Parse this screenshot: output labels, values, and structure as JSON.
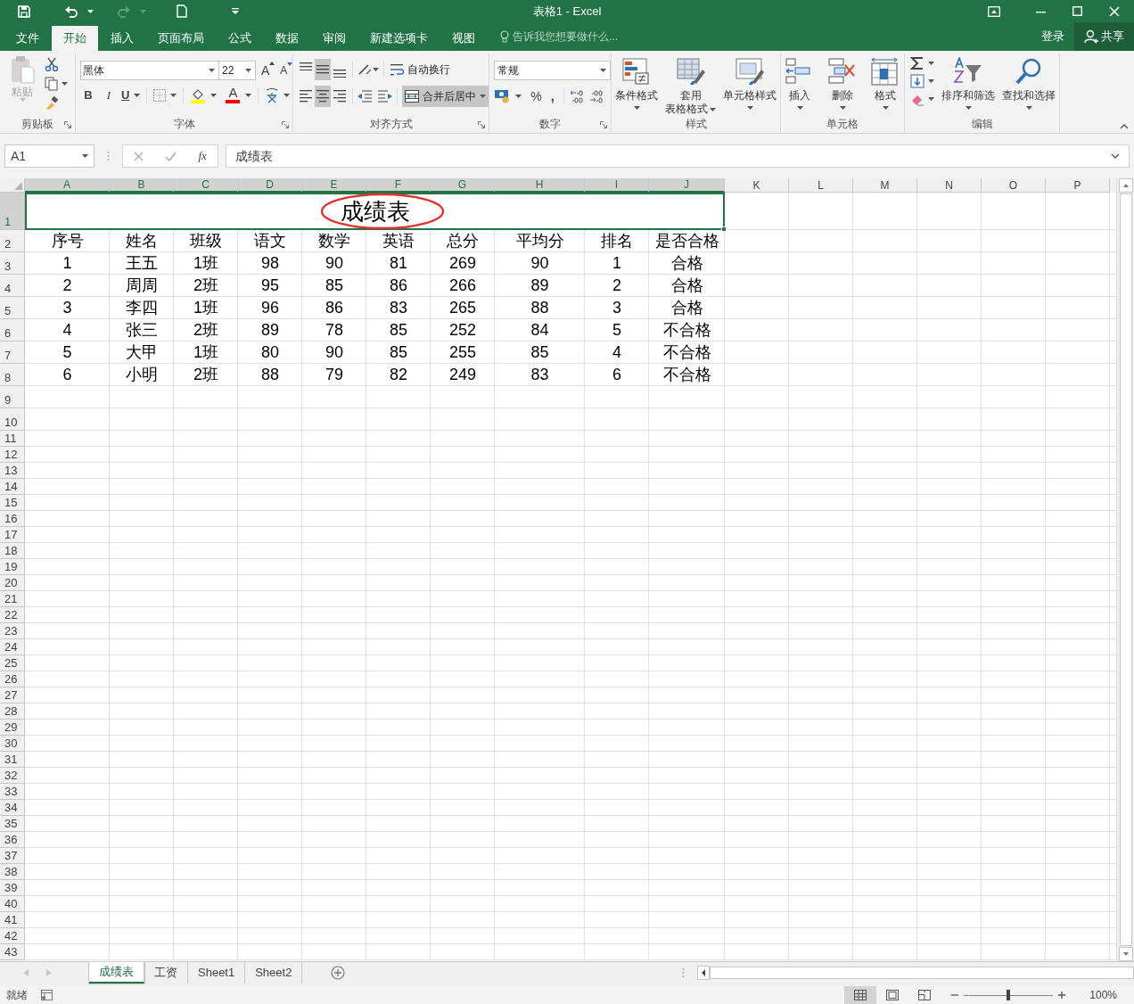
{
  "window": {
    "title": "表格1 - Excel"
  },
  "menu_tabs": [
    {
      "label": "文件",
      "selected": false
    },
    {
      "label": "开始",
      "selected": true
    },
    {
      "label": "插入",
      "selected": false
    },
    {
      "label": "页面布局",
      "selected": false
    },
    {
      "label": "公式",
      "selected": false
    },
    {
      "label": "数据",
      "selected": false
    },
    {
      "label": "审阅",
      "selected": false
    },
    {
      "label": "新建选项卡",
      "selected": false
    },
    {
      "label": "视图",
      "selected": false
    }
  ],
  "tell_me": {
    "placeholder": "告诉我您想要做什么..."
  },
  "account": {
    "sign_in": "登录",
    "share": "共享"
  },
  "ribbon": {
    "groups": [
      {
        "label": "剪贴板",
        "paste": {
          "label": "粘贴",
          "disabled": true
        }
      },
      {
        "label": "字体",
        "font_name": "黑体",
        "font_size": "22",
        "grow": "A",
        "shrink": "A",
        "bold": "B",
        "italic": "I",
        "underline": "U",
        "font_color": "A"
      },
      {
        "label": "对齐方式",
        "vertical": [
          {
            "kind": "top",
            "selected": false
          },
          {
            "kind": "middle",
            "selected": true
          },
          {
            "kind": "bottom",
            "selected": false
          }
        ],
        "horizontal": [
          {
            "kind": "left",
            "selected": false
          },
          {
            "kind": "center",
            "selected": true
          },
          {
            "kind": "right",
            "selected": false
          }
        ],
        "wrap_text": {
          "label": "自动换行",
          "selected": false
        },
        "merge": {
          "label": "合并后居中",
          "selected": true
        }
      },
      {
        "label": "数字",
        "format": "常规",
        "percent": "%",
        "comma": ","
      },
      {
        "label": "样式",
        "buttons": [
          {
            "kind": "conditional",
            "lines": [
              "条件格式"
            ]
          },
          {
            "kind": "table",
            "lines": [
              "套用",
              "表格格式"
            ]
          },
          {
            "kind": "cell_styles",
            "lines": [
              "单元格样式"
            ]
          }
        ]
      },
      {
        "label": "单元格",
        "buttons": [
          {
            "kind": "insert",
            "lines": [
              "插入"
            ]
          },
          {
            "kind": "delete",
            "lines": [
              "删除"
            ]
          },
          {
            "kind": "format",
            "lines": [
              "格式"
            ]
          }
        ]
      },
      {
        "label": "编辑",
        "buttons": [
          {
            "kind": "sort",
            "lines": [
              "排序和筛选"
            ]
          },
          {
            "kind": "find",
            "lines": [
              "查找和选择"
            ]
          }
        ]
      }
    ]
  },
  "formula_bar": {
    "name_box": "A1",
    "function_label": "fx",
    "value": "成绩表"
  },
  "sheet": {
    "columns": [
      {
        "label": "A",
        "selected": true
      },
      {
        "label": "B",
        "selected": true
      },
      {
        "label": "C",
        "selected": true
      },
      {
        "label": "D",
        "selected": true
      },
      {
        "label": "E",
        "selected": true
      },
      {
        "label": "F",
        "selected": true
      },
      {
        "label": "G",
        "selected": true
      },
      {
        "label": "H",
        "selected": true
      },
      {
        "label": "I",
        "selected": true
      },
      {
        "label": "J",
        "selected": true
      },
      {
        "label": "K",
        "selected": false
      },
      {
        "label": "L",
        "selected": false
      },
      {
        "label": "M",
        "selected": false
      },
      {
        "label": "N",
        "selected": false
      },
      {
        "label": "O",
        "selected": false
      },
      {
        "label": "P",
        "selected": false
      }
    ],
    "title_row": {
      "number": "1",
      "selected": true,
      "text": "成绩表",
      "circled": true
    },
    "rows": [
      {
        "number": "2",
        "selected": false,
        "cells": [
          "序号",
          "姓名",
          "班级",
          "语文",
          "数学",
          "英语",
          "总分",
          "平均分",
          "排名",
          "是否合格"
        ]
      },
      {
        "number": "3",
        "selected": false,
        "cells": [
          "1",
          "王五",
          "1班",
          "98",
          "90",
          "81",
          "269",
          "90",
          "1",
          "合格"
        ]
      },
      {
        "number": "4",
        "selected": false,
        "cells": [
          "2",
          "周周",
          "2班",
          "95",
          "85",
          "86",
          "266",
          "89",
          "2",
          "合格"
        ]
      },
      {
        "number": "5",
        "selected": false,
        "cells": [
          "3",
          "李四",
          "1班",
          "96",
          "86",
          "83",
          "265",
          "88",
          "3",
          "合格"
        ]
      },
      {
        "number": "6",
        "selected": false,
        "cells": [
          "4",
          "张三",
          "2班",
          "89",
          "78",
          "85",
          "252",
          "84",
          "5",
          "不合格"
        ]
      },
      {
        "number": "7",
        "selected": false,
        "cells": [
          "5",
          "大甲",
          "1班",
          "80",
          "90",
          "85",
          "255",
          "85",
          "4",
          "不合格"
        ]
      },
      {
        "number": "8",
        "selected": false,
        "cells": [
          "6",
          "小明",
          "2班",
          "88",
          "79",
          "82",
          "249",
          "83",
          "6",
          "不合格"
        ]
      },
      {
        "number": "9",
        "selected": false
      },
      {
        "number": "10",
        "selected": false
      },
      {
        "number": "11",
        "selected": false
      },
      {
        "number": "12",
        "selected": false
      },
      {
        "number": "13",
        "selected": false
      },
      {
        "number": "14",
        "selected": false
      },
      {
        "number": "15",
        "selected": false
      },
      {
        "number": "16",
        "selected": false
      },
      {
        "number": "17",
        "selected": false
      },
      {
        "number": "18",
        "selected": false
      },
      {
        "number": "19",
        "selected": false
      },
      {
        "number": "20",
        "selected": false
      },
      {
        "number": "21",
        "selected": false
      },
      {
        "number": "22",
        "selected": false
      },
      {
        "number": "23",
        "selected": false
      },
      {
        "number": "24",
        "selected": false
      },
      {
        "number": "25",
        "selected": false
      },
      {
        "number": "26",
        "selected": false
      },
      {
        "number": "27",
        "selected": false
      },
      {
        "number": "28",
        "selected": false
      },
      {
        "number": "29",
        "selected": false
      },
      {
        "number": "30",
        "selected": false
      },
      {
        "number": "31",
        "selected": false
      },
      {
        "number": "32",
        "selected": false
      },
      {
        "number": "33",
        "selected": false
      },
      {
        "number": "34",
        "selected": false
      },
      {
        "number": "35",
        "selected": false
      },
      {
        "number": "36",
        "selected": false
      },
      {
        "number": "37",
        "selected": false
      },
      {
        "number": "38",
        "selected": false
      },
      {
        "number": "39",
        "selected": false
      },
      {
        "number": "40",
        "selected": false
      },
      {
        "number": "41",
        "selected": false
      },
      {
        "number": "42",
        "selected": false
      },
      {
        "number": "43",
        "selected": false
      }
    ]
  },
  "sheet_tabs": [
    {
      "label": "成绩表",
      "selected": true
    },
    {
      "label": "工资",
      "selected": false
    },
    {
      "label": "Sheet1",
      "selected": false
    },
    {
      "label": "Sheet2",
      "selected": false
    }
  ],
  "status_bar": {
    "status": "就绪",
    "views": [
      {
        "kind": "normal",
        "selected": true
      },
      {
        "kind": "page_layout",
        "selected": false
      },
      {
        "kind": "page_break",
        "selected": false
      }
    ],
    "zoom": {
      "level": 0.5,
      "label": "100%"
    }
  }
}
